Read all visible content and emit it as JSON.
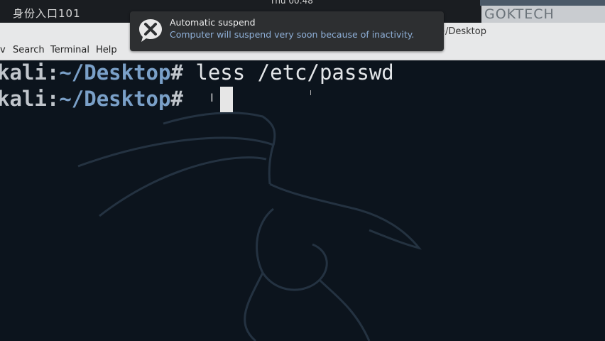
{
  "system_bar": {
    "left_text": "身份入口101",
    "clock": "Thu 00:48"
  },
  "brand": {
    "label": "GOKTECH"
  },
  "window": {
    "title": "root@kali: ~/Desktop"
  },
  "menu": {
    "items": [
      "View",
      "Search",
      "Terminal",
      "Help"
    ],
    "visible_labels": [
      "v",
      "Search",
      "Terminal",
      "Help"
    ]
  },
  "notification": {
    "title": "Automatic suspend",
    "body": "Computer will suspend very soon because of inactivity.",
    "icon": "suspend-warning-icon"
  },
  "terminal": {
    "lines": [
      {
        "host": "kali",
        "sep": ":",
        "path": "~/Desktop",
        "hash": "#",
        "command": " less /etc/passwd"
      },
      {
        "host": "kali",
        "sep": ":",
        "path": "~/Desktop",
        "hash": "#",
        "command": " "
      }
    ],
    "colors": {
      "background": "#0c141d",
      "path": "#7aa0c8",
      "text": "#e3e6e9"
    }
  }
}
